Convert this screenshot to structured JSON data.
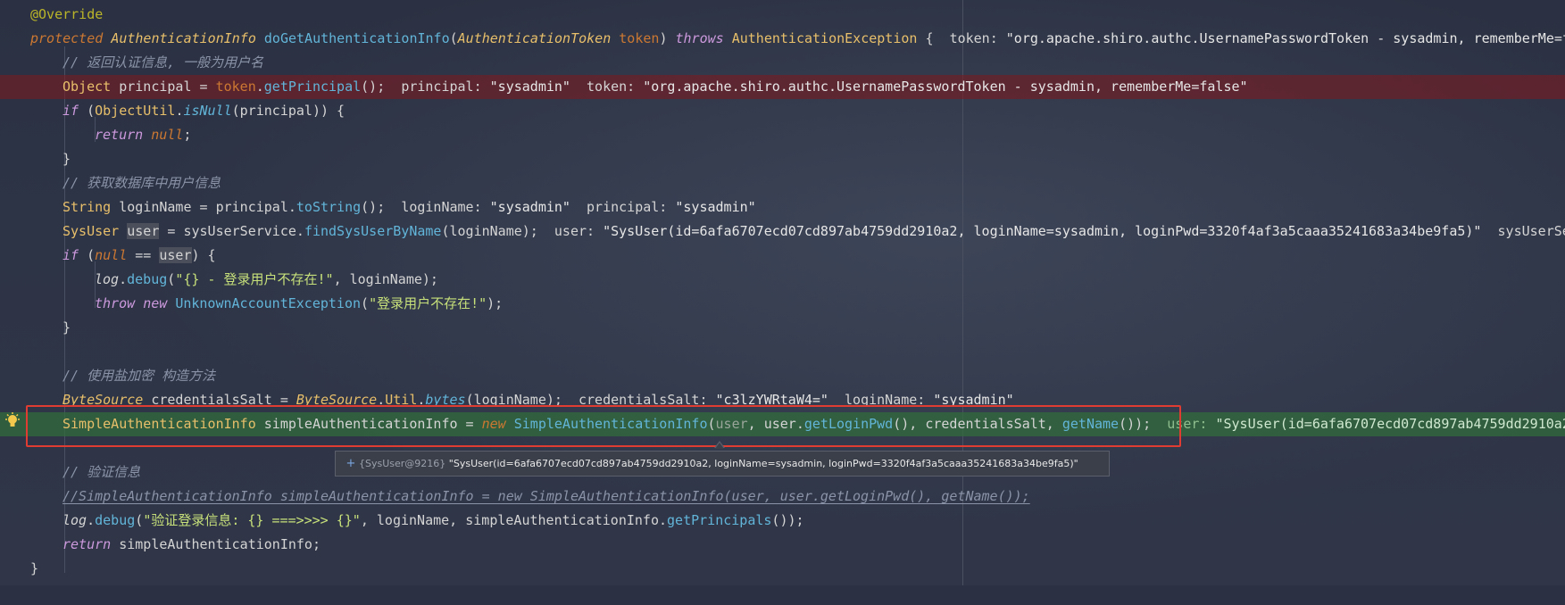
{
  "colors": {
    "breakpoint_row": "#781c22",
    "execution_row": "#306e3a",
    "highlight_box": "#e03c31",
    "keyword": "#cc7832",
    "type": "#e8bf6a",
    "method": "#62b5d9",
    "string": "#c7e07a",
    "comment": "#8a93a8"
  },
  "code": {
    "l1": {
      "annotation": "@Override"
    },
    "l2": {
      "kw_protected": "protected",
      "ret_type": "AuthenticationInfo",
      "method": "doGetAuthenticationInfo",
      "p_open": "(",
      "param_type": "AuthenticationToken",
      "param_name": "token",
      "p_close": ")",
      "kw_throws": "throws",
      "exc": "AuthenticationException",
      "brace": " {",
      "hint_key": "token:",
      "hint_val": "\"org.apache.shiro.authc.UsernamePasswordToken - sysadmin, rememberMe=false\""
    },
    "l3": {
      "comment": "// 返回认证信息, 一般为用户名"
    },
    "l4": {
      "type": "Object",
      "var": " principal = ",
      "obj": "token",
      "dot": ".",
      "call": "getPrincipal",
      "end": "();",
      "h1k": "principal:",
      "h1v": "\"sysadmin\"",
      "h2k": "token:",
      "h2v": "\"org.apache.shiro.authc.UsernamePasswordToken - sysadmin, rememberMe=false\""
    },
    "l5": {
      "kw_if": "if",
      "open": " (",
      "cls": "ObjectUtil",
      "dot": ".",
      "call": "isNull",
      "rest": "(principal)) {"
    },
    "l6": {
      "kw_return": "return",
      "kw_null": "null",
      "semi": ";"
    },
    "l7": {
      "close": "}"
    },
    "l8": {
      "comment": "// 获取数据库中用户信息"
    },
    "l9": {
      "type": "String",
      "var": " loginName = principal.",
      "call": "toString",
      "end": "();",
      "h1k": "loginName:",
      "h1v": "\"sysadmin\"",
      "h2k": "principal:",
      "h2v": "\"sysadmin\""
    },
    "l10": {
      "type": "SysUser",
      "space": " ",
      "var": "user",
      "mid": " = sysUserService.",
      "call": "findSysUserByName",
      "end": "(loginName);",
      "h1k": "user:",
      "h1v": "\"SysUser(id=6afa6707ecd07cd897ab4759dd2910a2, loginName=sysadmin, loginPwd=3320f4af3a5caaa35241683a34be9fa5)\"",
      "h2k": "sysUserSe"
    },
    "l11": {
      "kw_if": "if",
      "open": " (",
      "kw_null": "null",
      "eq": " == ",
      "var": "user",
      "rest": ") {"
    },
    "l12": {
      "log": "log",
      "dot": ".",
      "call": "debug",
      "open": "(",
      "str": "\"{} - 登录用户不存在!\"",
      "rest": ", loginName);"
    },
    "l13": {
      "kw_throw": "throw",
      "kw_new": "new",
      "cls": "UnknownAccountException",
      "open": "(",
      "str": "\"登录用户不存在!\"",
      "rest": ");"
    },
    "l14": {
      "close": "}"
    },
    "l16": {
      "comment": "// 使用盐加密 构造方法"
    },
    "l17": {
      "type": "ByteSource",
      "var": " credentialsSalt = ",
      "cls": "ByteSource",
      "dot1": ".",
      "util": "Util",
      "dot2": ".",
      "call": "bytes",
      "end": "(loginName);",
      "h1k": "credentialsSalt:",
      "h1v": "\"c3lzYWRtaW4=\"",
      "h2k": "loginName:",
      "h2v": "\"sysadmin\""
    },
    "l18": {
      "type": "SimpleAuthenticationInfo",
      "var": " simpleAuthenticationInfo = ",
      "kw_new": "new",
      "cls": "SimpleAuthenticationInfo",
      "open": "(",
      "arg_user": "user",
      "mid": ", user.",
      "call1": "getLoginPwd",
      "mid2": "(), credentialsSalt, ",
      "call2": "getName",
      "end": "());",
      "h1k": "user:",
      "h1v": "\"SysUser(id=6afa6707ecd07cd897ab4759dd2910a2"
    },
    "l20": {
      "comment": "// 验证信息"
    },
    "l21": {
      "comment": "//SimpleAuthenticationInfo simpleAuthenticationInfo = new SimpleAuthenticationInfo(user, user.getLoginPwd(), getName());"
    },
    "l22": {
      "log": "log",
      "dot": ".",
      "call": "debug",
      "open": "(",
      "str": "\"验证登录信息: {} ===>>>> {}\"",
      "mid": ", loginName, simpleAuthenticationInfo.",
      "call2": "getPrincipals",
      "end": "());"
    },
    "l23": {
      "kw_return": "return",
      "rest": " simpleAuthenticationInfo;"
    },
    "l24": {
      "close": "}"
    }
  },
  "tooltip": {
    "expand": "+",
    "ref": "{SysUser@9216}",
    "value": "\"SysUser(id=6afa6707ecd07cd897ab4759dd2910a2, loginName=sysadmin, loginPwd=3320f4af3a5caaa35241683a34be9fa5)\""
  },
  "icons": {
    "bulb": "lightbulb-icon"
  }
}
